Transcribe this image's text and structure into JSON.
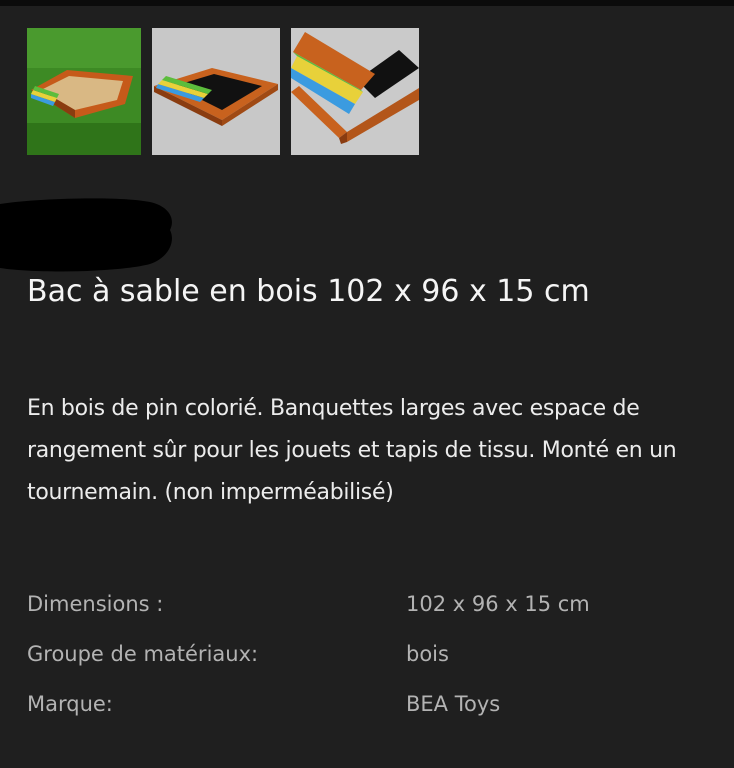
{
  "gallery": {
    "thumbnails": [
      {
        "icon": "sandbox-on-grass-photo"
      },
      {
        "icon": "sandbox-open-photo"
      },
      {
        "icon": "sandbox-bench-closeup-photo"
      }
    ]
  },
  "product": {
    "title": "Bac à sable en bois 102 x 96 x 15 cm",
    "description": "En bois de pin colorié. Banquettes larges avec espace de rangement sûr pour les jouets et tapis de tissu. Monté en un tournemain. (non imperméabilisé)"
  },
  "specs": [
    {
      "label": "Dimensions :",
      "value": "102 x 96 x 15 cm"
    },
    {
      "label": "Groupe de matériaux:",
      "value": "bois"
    },
    {
      "label": "Marque:",
      "value": "BEA Toys"
    }
  ],
  "colors": {
    "background": "#1f1f1f",
    "text": "#f2f2f2",
    "spec_text": "#b3b3b3",
    "wood": "#c8621e"
  }
}
